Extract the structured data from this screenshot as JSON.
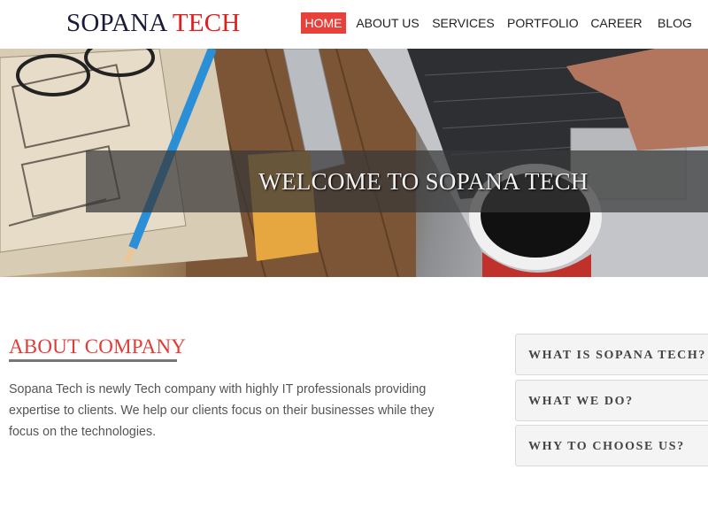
{
  "brand": {
    "name_part1": "SOPANA",
    "name_part2": "TECH",
    "color_dark": "#1b1b3a",
    "color_accent": "#e01e1e"
  },
  "nav": {
    "items": [
      {
        "label": "HOME",
        "active": true
      },
      {
        "label": "ABOUT US",
        "active": false
      },
      {
        "label": "SERVICES",
        "active": false
      },
      {
        "label": "PORTFOLIO",
        "active": false
      },
      {
        "label": "CAREER",
        "active": false
      },
      {
        "label": "BLOG",
        "active": false
      }
    ],
    "active_color": "#e8413b"
  },
  "hero": {
    "caption": "WELCOME TO SOPANA TECH",
    "slides_count": 3,
    "active_slide": 1
  },
  "about": {
    "title": "ABOUT COMPANY",
    "text": "Sopana Tech is newly Tech company with highly IT professionals  providing expertise to clients. We help our clients focus on their businesses while they focus on the technologies."
  },
  "accordion": {
    "items": [
      {
        "label": "WHAT IS SOPANA TECH?"
      },
      {
        "label": "WHAT WE DO?"
      },
      {
        "label": "WHY TO CHOOSE US?"
      }
    ]
  }
}
